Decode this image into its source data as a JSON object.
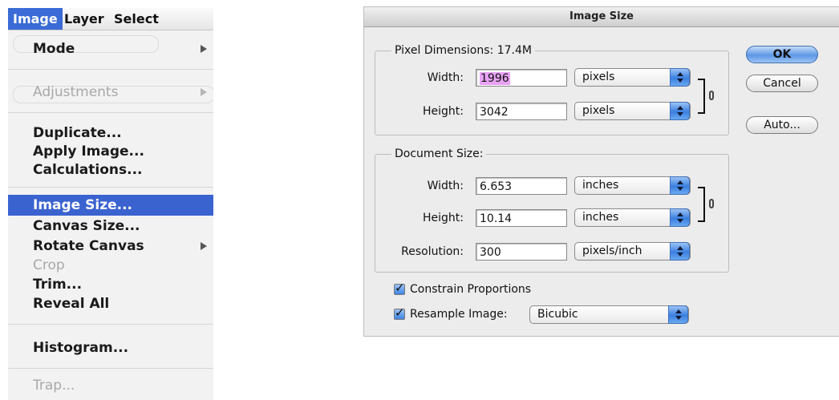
{
  "menubar": {
    "items": [
      {
        "label": "Image",
        "active": true
      },
      {
        "label": "Layer",
        "active": false
      },
      {
        "label": "Select",
        "active": false
      }
    ]
  },
  "menu": {
    "items": [
      {
        "label": "Mode",
        "enabled": true,
        "submenu": true
      },
      {
        "label": "Adjustments",
        "enabled": false,
        "submenu": true
      },
      {
        "label": "Duplicate...",
        "enabled": true
      },
      {
        "label": "Apply Image...",
        "enabled": true
      },
      {
        "label": "Calculations...",
        "enabled": true
      },
      {
        "label": "Image Size...",
        "enabled": true,
        "highlighted": true
      },
      {
        "label": "Canvas Size...",
        "enabled": true
      },
      {
        "label": "Rotate Canvas",
        "enabled": true,
        "submenu": true
      },
      {
        "label": "Crop",
        "enabled": false
      },
      {
        "label": "Trim...",
        "enabled": true
      },
      {
        "label": "Reveal All",
        "enabled": true
      },
      {
        "label": "Histogram...",
        "enabled": true
      },
      {
        "label": "Trap...",
        "enabled": false
      }
    ],
    "highlight_color": "#3b63d0"
  },
  "dialog": {
    "title": "Image Size",
    "pixel_dimensions": {
      "title": "Pixel Dimensions:",
      "size": "17.4M",
      "width_label": "Width:",
      "width_value": "1996",
      "width_unit": "pixels",
      "height_label": "Height:",
      "height_value": "3042",
      "height_unit": "pixels"
    },
    "document_size": {
      "title": "Document Size:",
      "width_label": "Width:",
      "width_value": "6.653",
      "width_unit": "inches",
      "height_label": "Height:",
      "height_value": "10.14",
      "height_unit": "inches",
      "resolution_label": "Resolution:",
      "resolution_value": "300",
      "resolution_unit": "pixels/inch"
    },
    "constrain_label": "Constrain Proportions",
    "constrain_checked": true,
    "resample_label": "Resample Image:",
    "resample_checked": true,
    "resample_method": "Bicubic",
    "buttons": {
      "ok": "OK",
      "cancel": "Cancel",
      "auto": "Auto..."
    }
  }
}
